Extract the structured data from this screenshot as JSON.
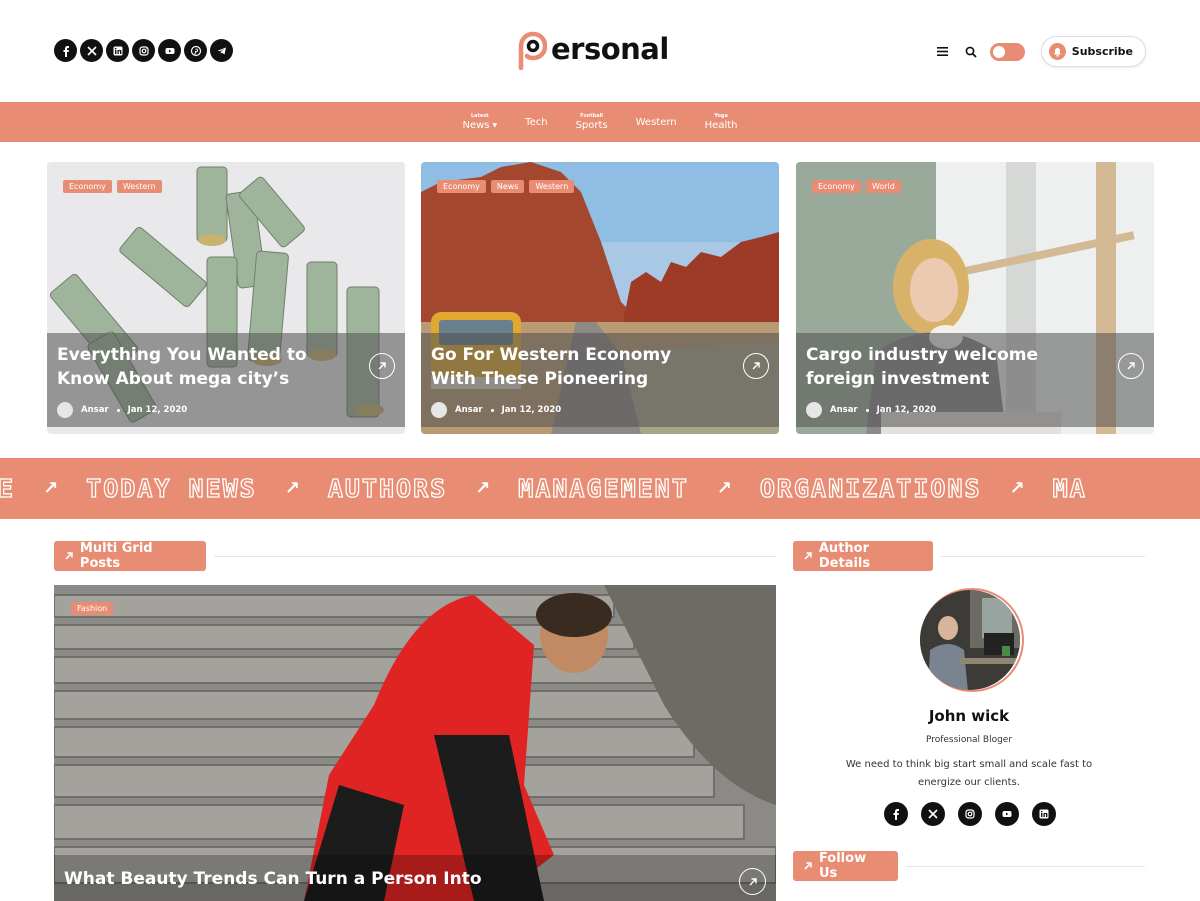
{
  "brand": {
    "logo_text": "ersonal",
    "accent": "#e88d73"
  },
  "header": {
    "social_icons": [
      "facebook-icon",
      "x-icon",
      "linkedin-icon",
      "instagram-icon",
      "youtube-icon",
      "pinterest-icon",
      "telegram-icon"
    ],
    "subscribe_label": "Subscribe"
  },
  "nav": [
    {
      "badge": "Latest",
      "label": "News",
      "has_dropdown": true
    },
    {
      "badge": "",
      "label": "Tech"
    },
    {
      "badge": "Football",
      "label": "Sports"
    },
    {
      "badge": "",
      "label": "Western"
    },
    {
      "badge": "Yoga",
      "label": "Health"
    }
  ],
  "featured": [
    {
      "tags": [
        "Economy",
        "Western"
      ],
      "title": "Everything You Wanted to Know About mega city’s",
      "author": "Ansar",
      "date": "Jan 12, 2020"
    },
    {
      "tags": [
        "Economy",
        "News",
        "Western"
      ],
      "title": "Go For Western Economy With These Pioneering",
      "author": "Ansar",
      "date": "Jan 12, 2020"
    },
    {
      "tags": [
        "Economy",
        "World"
      ],
      "title": "Cargo industry welcome foreign investment",
      "author": "Ansar",
      "date": "Jan 12, 2020"
    }
  ],
  "ticker": [
    "NE",
    "TODAY NEWS",
    "AUTHORS",
    "MANAGEMENT",
    "ORGANIZATIONS",
    "MA"
  ],
  "sections": {
    "multi_grid": "Multi Grid Posts",
    "author_details": "Author Details",
    "follow_us": "Follow Us"
  },
  "big_post": {
    "tag": "Fashion",
    "title": "What Beauty Trends Can Turn a Person Into"
  },
  "author": {
    "name": "John wick",
    "role": "Professional Bloger",
    "bio": "We need to think big start small and scale fast to energize our clients.",
    "social_icons": [
      "facebook-icon",
      "x-icon",
      "instagram-icon",
      "youtube-icon",
      "linkedin-icon"
    ]
  }
}
